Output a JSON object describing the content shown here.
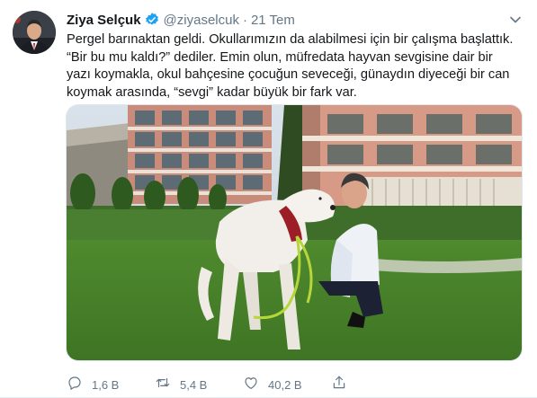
{
  "tweet": {
    "author_name": "Ziya Selçuk",
    "handle": "@ziyaselcuk",
    "separator": "·",
    "date": "21 Tem",
    "text_lines": [
      "Pergel barınaktan geldi. Okullarımızın da alabilmesi için bir çalışma başlattık.",
      "“Bir bu mu kaldı?” dediler. Emin olun, müfredata hayvan sevgisine dair bir",
      "yazı koymakla, okul bahçesine çocuğun seveceği, günaydın diyeceği bir can",
      "koymak arasında, “sevgi” kadar büyük bir fark var."
    ],
    "verified_icon": "verified-badge-icon",
    "menu_icon": "chevron-down-icon"
  },
  "actions": {
    "reply": {
      "icon": "reply-icon",
      "count": "1,6 B"
    },
    "retweet": {
      "icon": "retweet-icon",
      "count": "5,4 B"
    },
    "like": {
      "icon": "heart-icon",
      "count": "40,2 B"
    },
    "share": {
      "icon": "share-icon"
    }
  },
  "colors": {
    "text_primary": "#14171a",
    "text_secondary": "#657786",
    "verified_blue": "#1da1f2",
    "border": "#e6ecf0"
  }
}
